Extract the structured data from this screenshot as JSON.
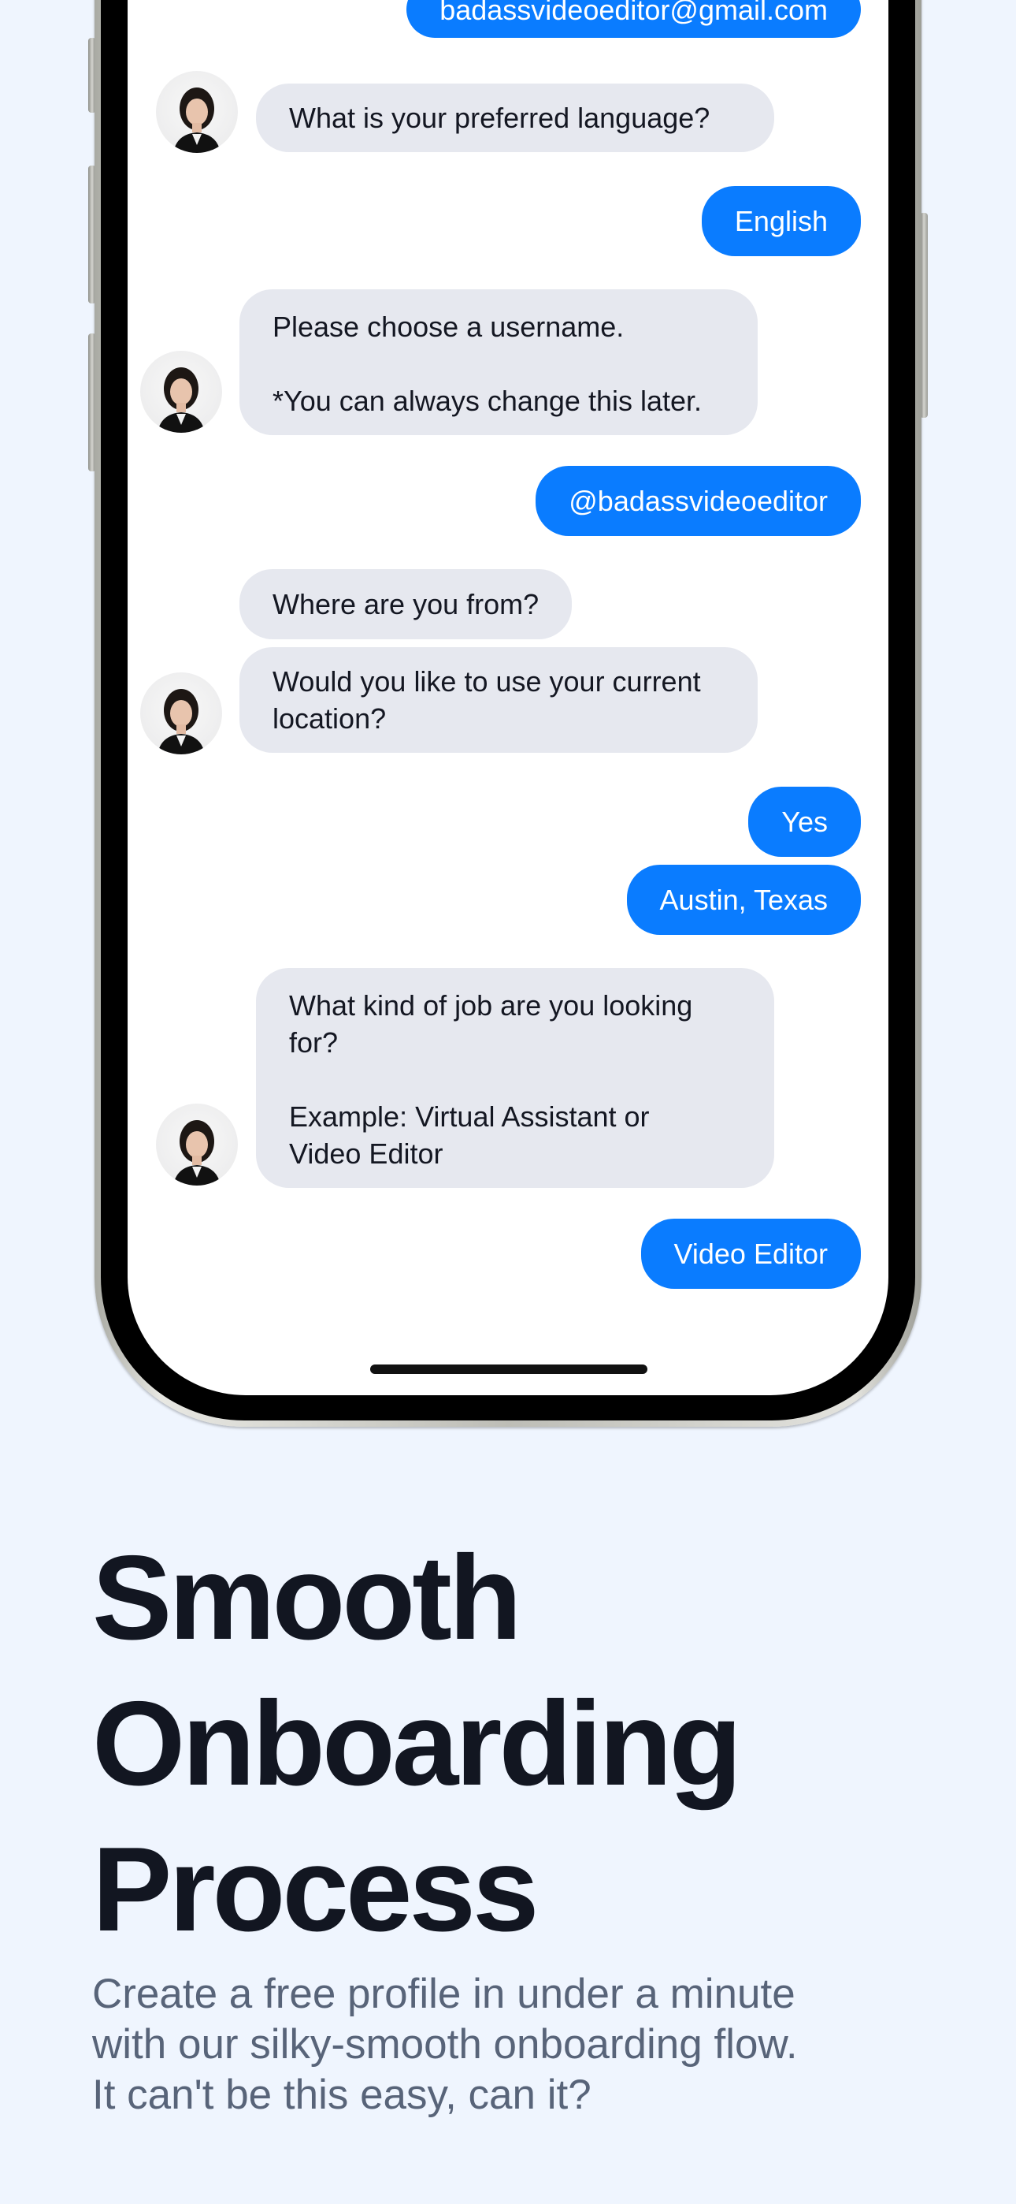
{
  "chat": {
    "messages": [
      {
        "role": "user",
        "text": "badassvideoeditor@gmail.com"
      },
      {
        "role": "bot",
        "lines": [
          "What is your preferred language?"
        ]
      },
      {
        "role": "user",
        "text": "English"
      },
      {
        "role": "bot",
        "lines": [
          "Please choose a username.",
          "",
          "*You can always change this later."
        ]
      },
      {
        "role": "user",
        "text": "@badassvideoeditor"
      },
      {
        "role": "bot",
        "lines": [
          "Where are you from?"
        ]
      },
      {
        "role": "bot",
        "lines": [
          "Would you like to use your current",
          "location?"
        ]
      },
      {
        "role": "user",
        "text": "Yes"
      },
      {
        "role": "user",
        "text": "Austin, Texas"
      },
      {
        "role": "bot",
        "lines": [
          "What kind of job are you looking",
          "for?",
          "",
          "Example: Virtual Assistant or",
          "Video Editor"
        ]
      },
      {
        "role": "user",
        "text": "Video Editor"
      }
    ]
  },
  "hero": {
    "headline_lines": [
      "Smooth",
      "Onboarding",
      "Process"
    ],
    "subtitle_lines": [
      "Create a free profile in under a minute",
      "with our silky-smooth onboarding flow.",
      "It can't be this easy, can it?"
    ]
  },
  "colors": {
    "background": "#EFF5FE",
    "user_bubble": "#0A7CFF",
    "bot_bubble": "#E6E8EF",
    "headline": "#121621",
    "subtitle": "#586479"
  }
}
